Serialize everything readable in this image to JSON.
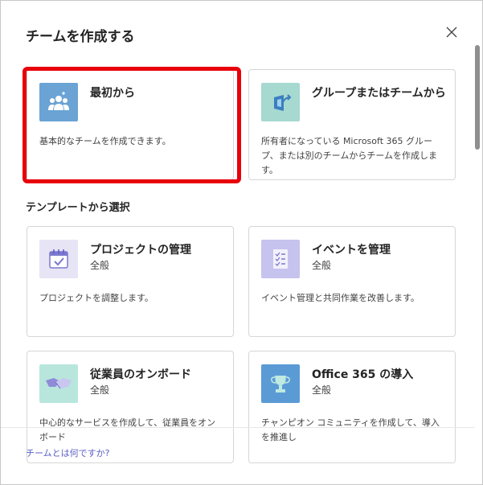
{
  "dialog": {
    "title": "チームを作成する",
    "close_icon": "close-icon"
  },
  "create_options": [
    {
      "name": "最初から",
      "description": "基本的なチームを作成できます。",
      "icon": "team-people-icon",
      "icon_bg": "#6aa3d4"
    },
    {
      "name": "グループまたはチームから",
      "description": "所有者になっている Microsoft 365 グループ、または別のチームからチームを作成します。",
      "icon": "import-arrow-icon",
      "icon_bg": "#a6d9d0"
    }
  ],
  "templates_label": "テンプレートから選択",
  "templates": [
    {
      "name": "プロジェクトの管理",
      "category": "全般",
      "description": "プロジェクトを調整します。",
      "icon": "calendar-check-icon",
      "icon_bg": "#e6e4f5"
    },
    {
      "name": "イベントを管理",
      "category": "全般",
      "description": "イベント管理と共同作業を改善します。",
      "icon": "checklist-icon",
      "icon_bg": "#c6c3ee"
    },
    {
      "name": "従業員のオンボード",
      "category": "全般",
      "description": "中心的なサービスを作成して、従業員をオンボード",
      "icon": "handshake-icon",
      "icon_bg": "#b8e6dd"
    },
    {
      "name": "Office 365 の導入",
      "category": "全般",
      "description": "チャンピオン コミュニティを作成して、導入を推進し",
      "icon": "trophy-icon",
      "icon_bg": "#5b9bd5"
    }
  ],
  "footer": {
    "link": "チームとは何ですか?"
  },
  "colors": {
    "highlight": "#e8000b",
    "link": "#5b5fc7"
  }
}
